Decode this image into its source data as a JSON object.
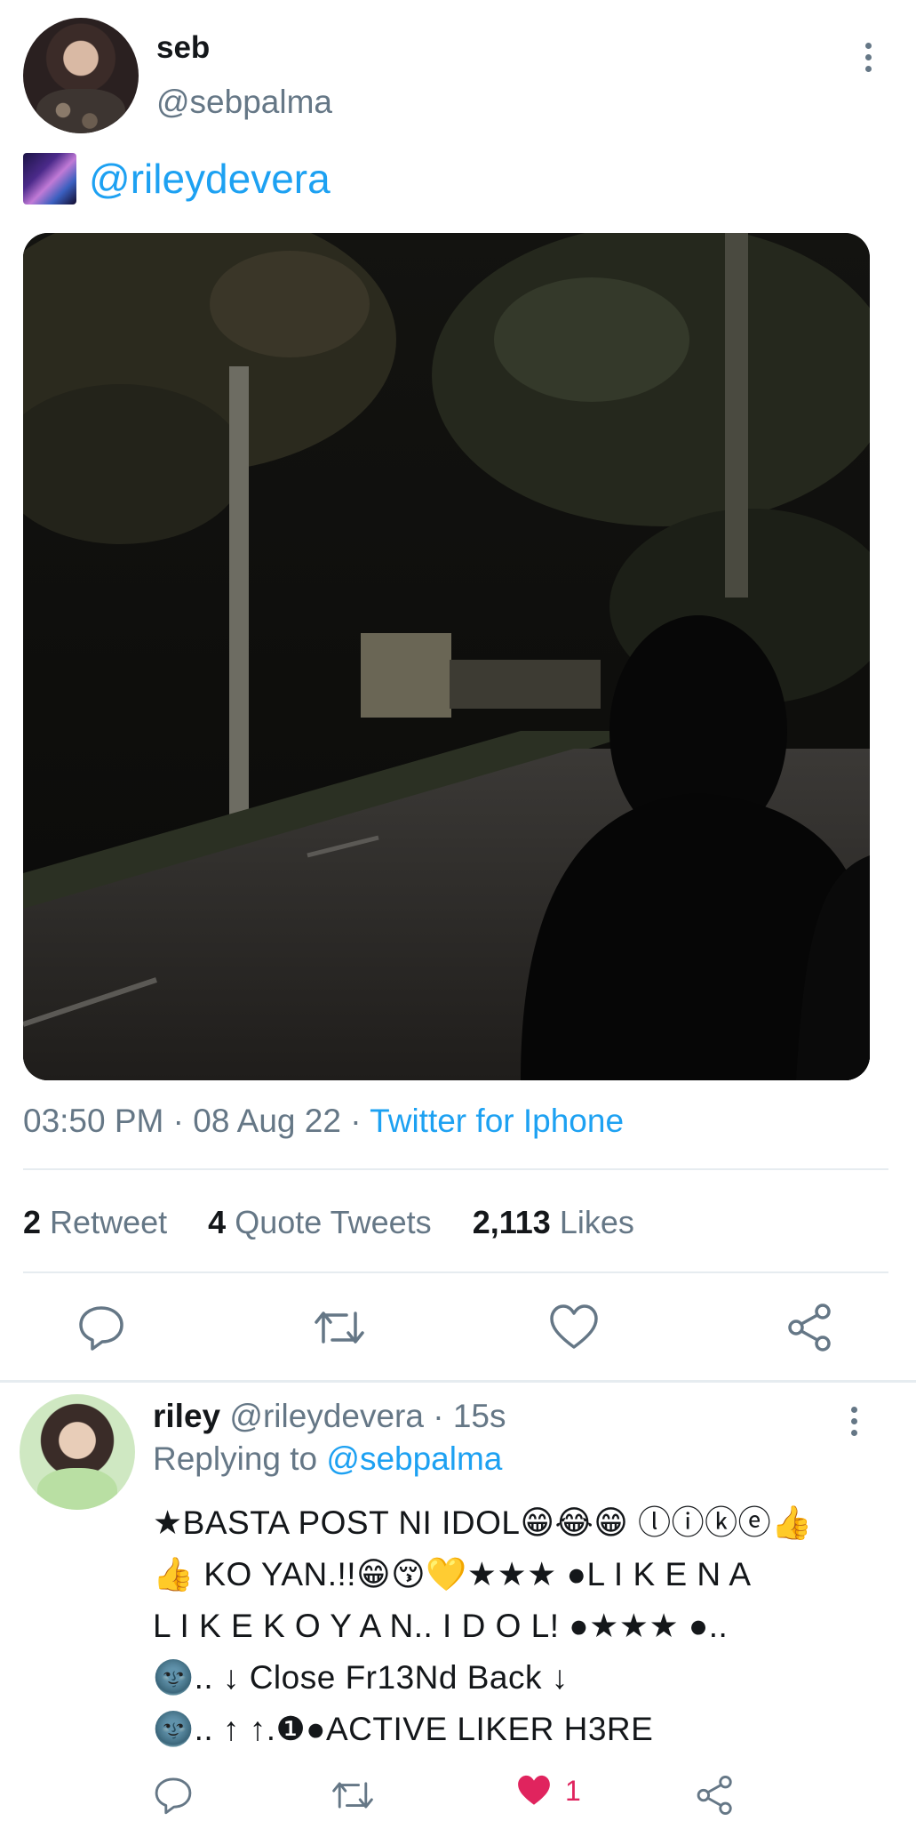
{
  "tweet": {
    "author_name": "seb",
    "author_handle": "@sebpalma",
    "mention": "@rileydevera",
    "time": "03:50 PM",
    "sep1": "·",
    "date": "08 Aug 22",
    "sep2": "·",
    "source": "Twitter for Iphone",
    "stats": {
      "retweets_count": "2",
      "retweets_label": "Retweet",
      "quotes_count": "4",
      "quotes_label": "Quote Tweets",
      "likes_count": "2,113",
      "likes_label": "Likes"
    }
  },
  "reply": {
    "author_name": "riley",
    "author_handle": "@rileydevera",
    "sep": "·",
    "time_ago": "15s",
    "replying_to_label": "Replying to",
    "replying_to_handle": "@sebpalma",
    "lines": [
      "★BASTA POST NI IDOL😁😂😁 ⓛⓘⓚⓔ👍",
      "👍 KO YAN.!!😁😚💛★★★ ●L I K E N A",
      "L I K E K O Y A N.. I D O L! ●★★★ ●..",
      "🌚.. ↓ Close Fr13Nd Back ↓",
      "🌚.. ↑ ↑.❶●ACTIVE LIKER H3RE"
    ],
    "like_count": "1"
  },
  "colors": {
    "accent": "#1da1f2",
    "secondary_text": "#657786",
    "like_red": "#e0245e",
    "divider": "#e6ecf0"
  },
  "icons": [
    "more-vert-icon",
    "reply-icon",
    "retweet-icon",
    "like-icon",
    "share-icon"
  ]
}
